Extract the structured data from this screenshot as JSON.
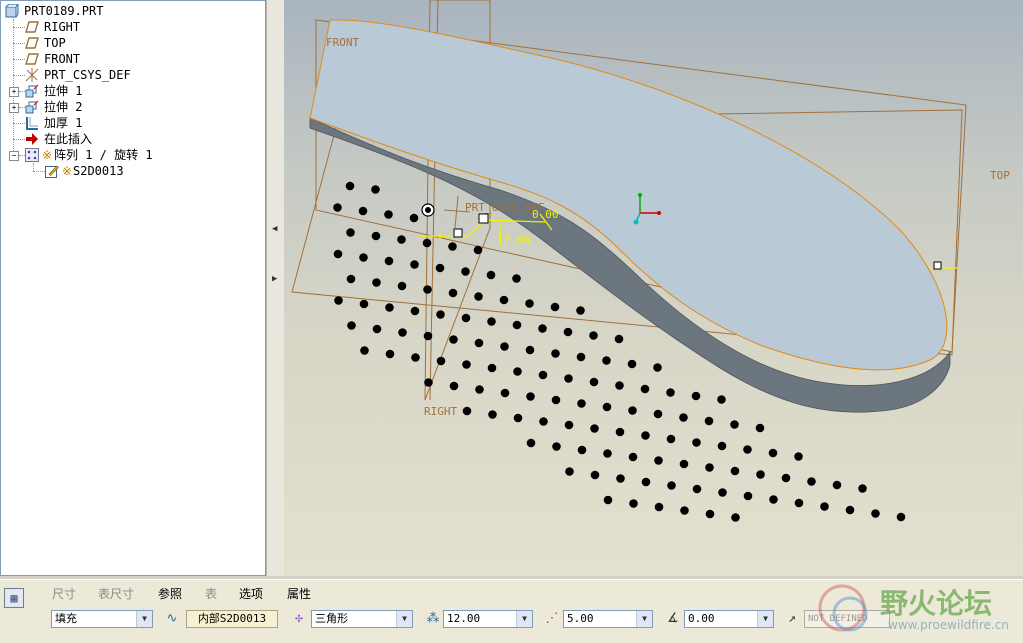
{
  "tree": {
    "items": [
      {
        "label": "PRT0189.PRT",
        "icon": "part-icon"
      },
      {
        "label": "RIGHT",
        "icon": "datum-plane-icon"
      },
      {
        "label": "TOP",
        "icon": "datum-plane-icon"
      },
      {
        "label": "FRONT",
        "icon": "datum-plane-icon"
      },
      {
        "label": "PRT_CSYS_DEF",
        "icon": "csys-icon"
      },
      {
        "label": "拉伸 1",
        "icon": "extrude-icon"
      },
      {
        "label": "拉伸 2",
        "icon": "extrude-icon"
      },
      {
        "label": "加厚 1",
        "icon": "thicken-icon"
      },
      {
        "label": "在此插入",
        "icon": "insert-here-arrow-icon"
      },
      {
        "label": "阵列 1 / 旋转 1",
        "icon": "pattern-icon"
      },
      {
        "label": "S2D0013",
        "icon": "sketch-icon"
      }
    ]
  },
  "viewport": {
    "labels": {
      "front": "FRONT",
      "top": "TOP",
      "right": "RIGHT",
      "csys": "PRT_CSYS_DEF"
    },
    "dims": {
      "spacing": "12.00",
      "angle": "0.00"
    }
  },
  "dashboard": {
    "tabs": [
      {
        "label": "尺寸",
        "dim": true
      },
      {
        "label": "表尺寸",
        "dim": true
      },
      {
        "label": "参照",
        "dim": false
      },
      {
        "label": "表",
        "dim": true
      },
      {
        "label": "选项",
        "dim": false
      },
      {
        "label": "属性",
        "dim": false
      }
    ],
    "fill_type": "填充",
    "sketch": "内部S2D0013",
    "arrangement": "三角形",
    "spacing": "12.00",
    "border": "5.00",
    "rotation": "0.00",
    "not_defined": "NOT DEFINED"
  },
  "watermark": {
    "text": "野火论坛",
    "url": "www.proewildfire.cn"
  },
  "colors": {
    "datum": "#a0703c",
    "dim": "#f2f200",
    "surface": "#b9c9d6",
    "edge": "#6f7a82"
  }
}
